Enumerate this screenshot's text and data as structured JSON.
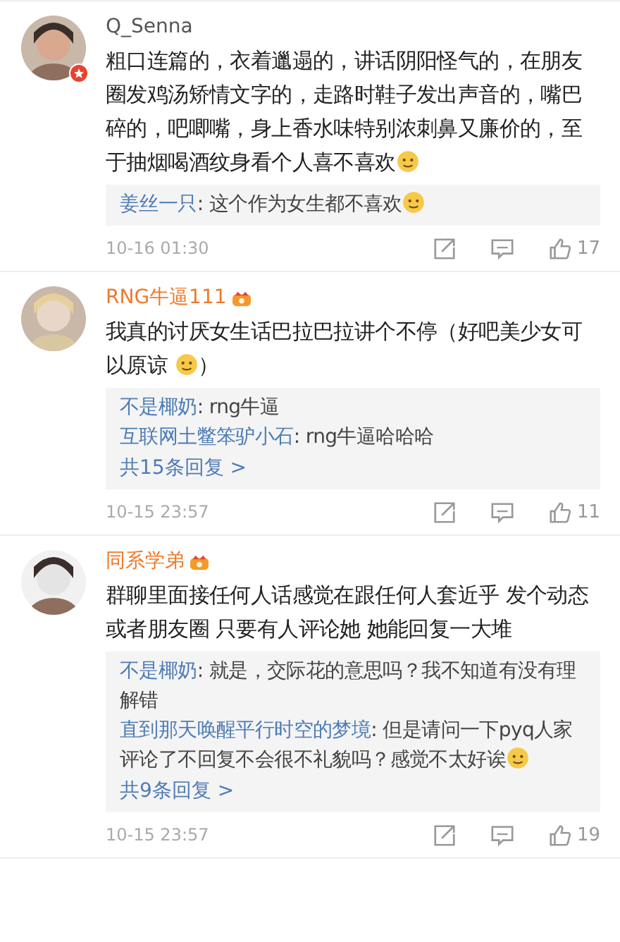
{
  "comments": [
    {
      "user": "Q_Senna",
      "vip": false,
      "badge": true,
      "parts": [
        {
          "kind": "text",
          "text": "粗口连篇的，衣着邋遢的，讲话阴阳怪气的，在朋友圈发鸡汤矫情文字的，走路时鞋子发出声音的，嘴巴碎的，吧唧嘴，身上香水味特别浓刺鼻又廉价的，至于抽烟喝酒纹身看个人喜不喜欢"
        },
        {
          "kind": "emoji"
        }
      ],
      "replies": [
        {
          "user": "姜丝一只",
          "parts": [
            {
              "kind": "text",
              "text": ": 这个作为女生都不喜欢"
            },
            {
              "kind": "emoji"
            }
          ]
        }
      ],
      "time": "10-16 01:30",
      "likes": "17"
    },
    {
      "user": "RNG牛逼111",
      "vip": true,
      "badge": false,
      "parts": [
        {
          "kind": "text",
          "text": "我真的讨厌女生话巴拉巴拉讲个不停（好吧美少女可以原谅 "
        },
        {
          "kind": "emoji"
        },
        {
          "kind": "text",
          "text": "）"
        }
      ],
      "replies": [
        {
          "user": "不是椰奶",
          "parts": [
            {
              "kind": "text",
              "text": ": rng牛逼"
            }
          ]
        },
        {
          "user": "互联网土鳖笨驴小石",
          "parts": [
            {
              "kind": "text",
              "text": ": rng牛逼哈哈哈"
            }
          ]
        }
      ],
      "more": "共15条回复 >",
      "time": "10-15 23:57",
      "likes": "11"
    },
    {
      "user": "同系学弟",
      "vip": true,
      "badge": false,
      "parts": [
        {
          "kind": "text",
          "text": "群聊里面接任何人话感觉在跟任何人套近乎 发个动态或者朋友圈 只要有人评论她 她能回复一大堆"
        }
      ],
      "replies": [
        {
          "user": "不是椰奶",
          "parts": [
            {
              "kind": "text",
              "text": ": 就是，交际花的意思吗？我不知道有没有理解错"
            }
          ]
        },
        {
          "user": "直到那天唤醒平行时空的梦境",
          "parts": [
            {
              "kind": "text",
              "text": ": 但是请问一下pyq人家评论了不回复不会很不礼貌吗？感觉不太好诶"
            },
            {
              "kind": "emoji"
            }
          ]
        }
      ],
      "more": "共9条回复 >",
      "time": "10-15 23:57",
      "likes": "19"
    }
  ]
}
